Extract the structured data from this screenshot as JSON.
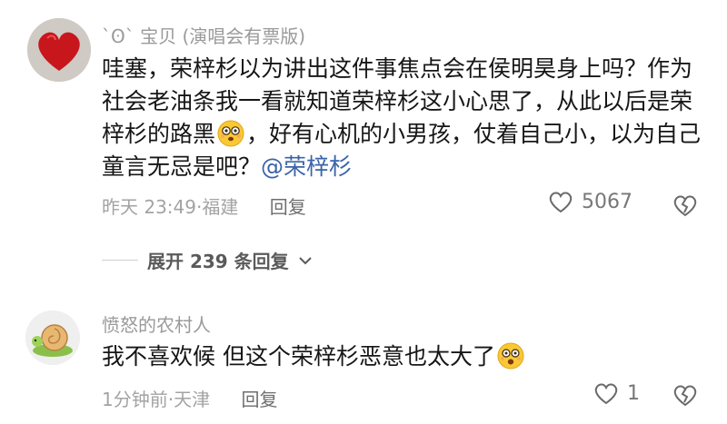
{
  "comment1": {
    "username": "`ʘ` 宝贝 (演唱会有票版)",
    "text_part1": "哇塞，荣梓杉以为讲出这件事焦点会在侯明昊身上吗？作为社会老油条我一看就知道荣梓杉这小心思了，从此以后是荣梓杉的路黑",
    "text_part2": "，好有心机的小男孩，仗着自己小，以为自己童言无忌是吧？",
    "mention": "@荣梓杉",
    "time_location": "昨天 23:49·福建",
    "reply_label": "回复",
    "like_count": "5067"
  },
  "expand": {
    "label": "展开 239 条回复"
  },
  "comment2": {
    "username": "愤怒的农村人",
    "text": "我不喜欢候 但这个荣梓杉恶意也太大了",
    "time_location": "1分钟前·天津",
    "reply_label": "回复",
    "like_count": "1"
  }
}
